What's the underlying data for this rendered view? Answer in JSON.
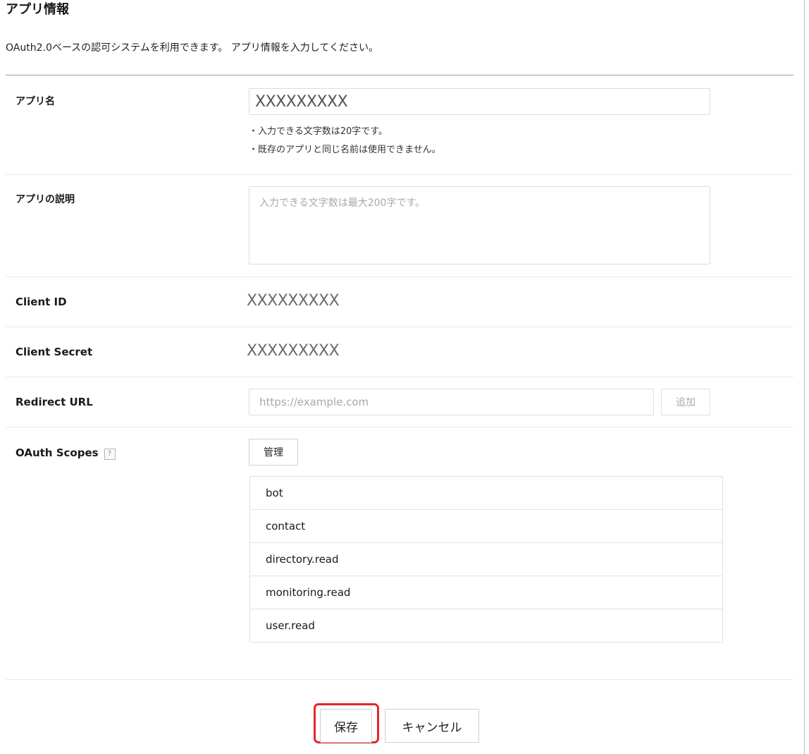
{
  "page": {
    "title": "アプリ情報",
    "intro": "OAuth2.0ベースの認可システムを利用できます。 アプリ情報を入力してください。"
  },
  "form": {
    "app_name": {
      "label": "アプリ名",
      "value": "XXXXXXXXX",
      "hints": [
        "・入力できる文字数は20字です。",
        "・既存のアプリと同じ名前は使用できません。"
      ]
    },
    "app_description": {
      "label": "アプリの説明",
      "value": "",
      "placeholder": "入力できる文字数は最大200字です。"
    },
    "client_id": {
      "label": "Client ID",
      "value": "XXXXXXXXX"
    },
    "client_secret": {
      "label": "Client Secret",
      "value": "XXXXXXXXX"
    },
    "redirect_url": {
      "label": "Redirect URL",
      "value": "",
      "placeholder": "https://example.com",
      "add_label": "追加"
    },
    "oauth_scopes": {
      "label": "OAuth Scopes",
      "help_icon": "?",
      "manage_label": "管理",
      "scopes": [
        "bot",
        "contact",
        "directory.read",
        "monitoring.read",
        "user.read"
      ]
    }
  },
  "footer": {
    "save_label": "保存",
    "cancel_label": "キャンセル",
    "highlight_color": "#e4262a"
  }
}
